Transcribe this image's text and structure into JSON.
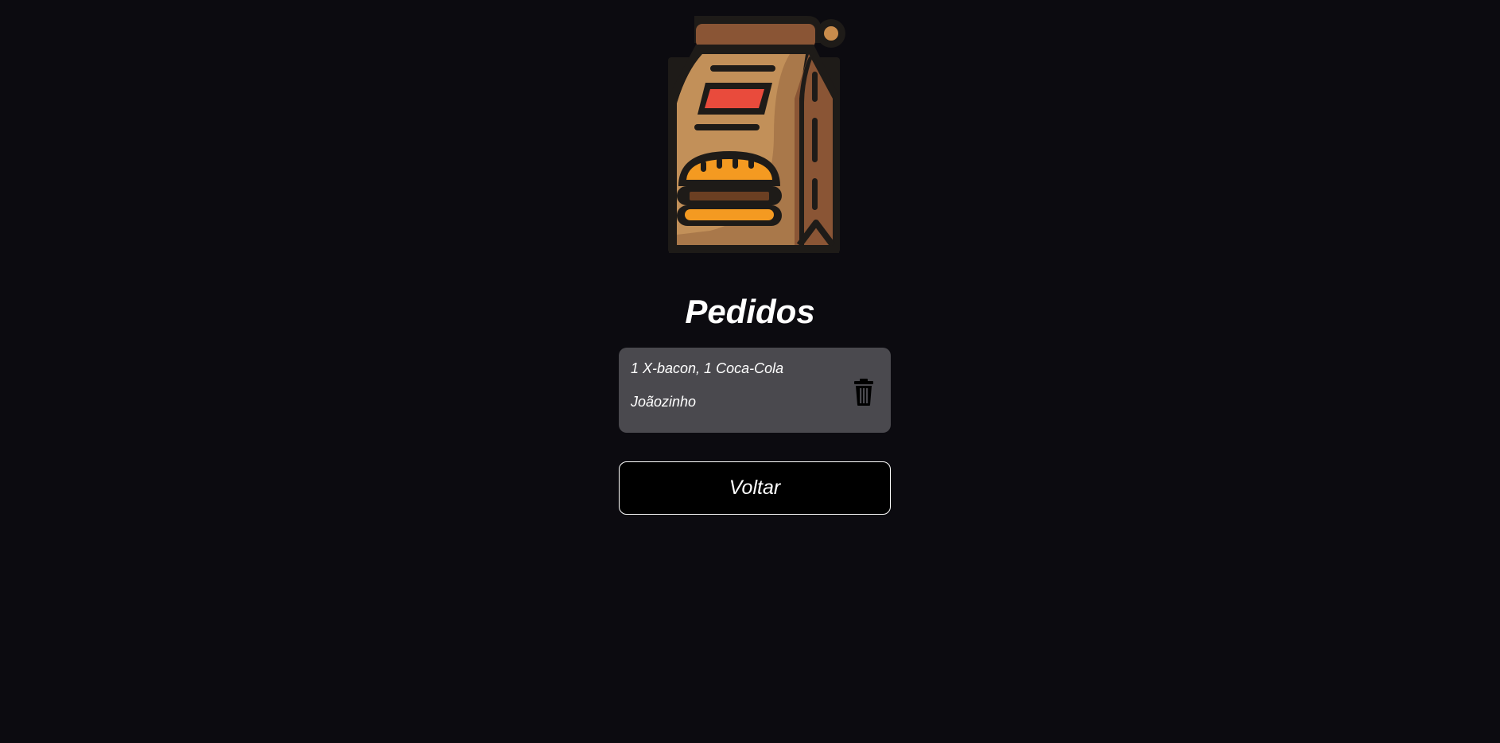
{
  "header": {
    "logo_icon": "food-delivery-bag-icon",
    "title": "Pedidos"
  },
  "orders": [
    {
      "items": "1 X-bacon, 1 Coca-Cola",
      "customer": "Joãozinho",
      "delete_icon": "trash-icon"
    }
  ],
  "actions": {
    "back_label": "Voltar"
  },
  "colors": {
    "background": "#0c0b10",
    "card": "#4a494e",
    "text": "#ffffff",
    "bag_light": "#b5834f",
    "bag_dark": "#8a5535",
    "label_red": "#e94b3c",
    "burger_orange": "#f49a21"
  }
}
